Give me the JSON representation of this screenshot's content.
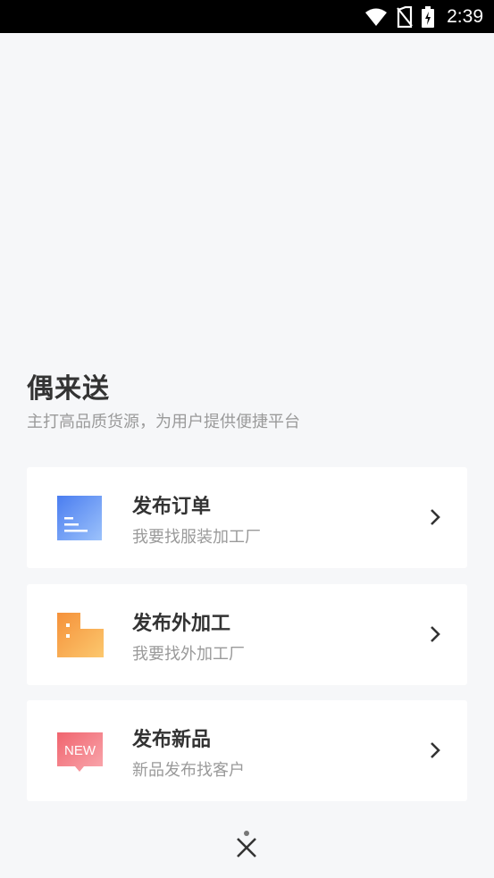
{
  "status_bar": {
    "time": "2:39",
    "icons": [
      "wifi-icon",
      "no-sim-icon",
      "battery-charging-icon"
    ]
  },
  "header": {
    "app_name": "偶来送",
    "slogan": "主打高品质货源，为用户提供便捷平台"
  },
  "options": [
    {
      "title": "发布订单",
      "subtitle": "我要找服装加工厂",
      "icon": "order-document-icon",
      "icon_colors": [
        "#4a7df0",
        "#8fb8fb"
      ]
    },
    {
      "title": "发布外加工",
      "subtitle": "我要找外加工厂",
      "icon": "factory-building-icon",
      "icon_colors": [
        "#f5913a",
        "#fbc46a"
      ]
    },
    {
      "title": "发布新品",
      "subtitle": "新品发布找客户",
      "icon": "new-badge-icon",
      "icon_colors": [
        "#f0646e",
        "#f8a0a8"
      ],
      "badge_text": "NEW"
    }
  ],
  "close": {
    "icon": "close-icon"
  },
  "colors": {
    "background": "#f6f7f9",
    "card": "#ffffff",
    "title_text": "#333333",
    "secondary_text": "#9a9a9a"
  }
}
